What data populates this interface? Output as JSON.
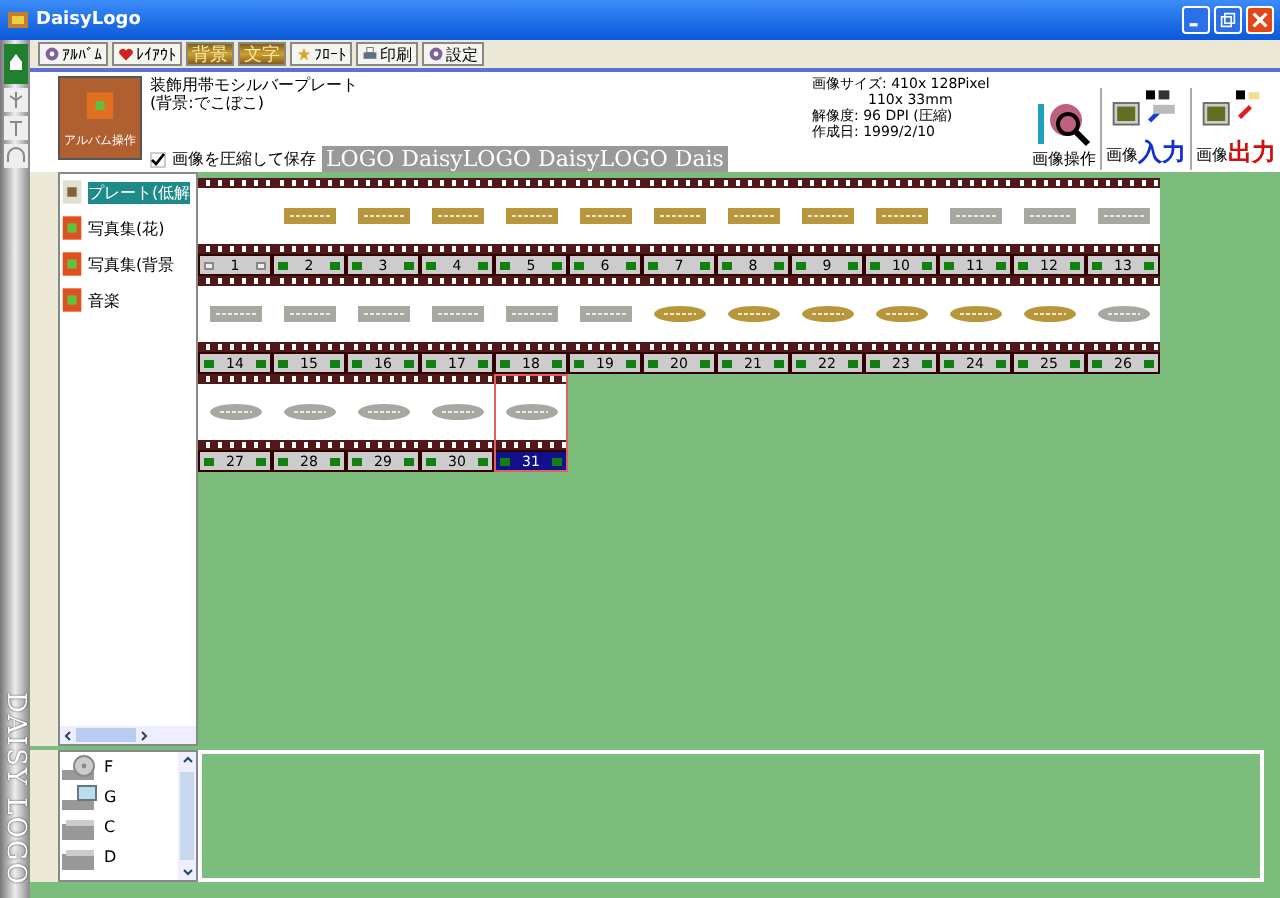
{
  "window": {
    "title": "DaisyLogo"
  },
  "side_strip": {
    "label": "DAISY LOGO"
  },
  "toolbar": [
    {
      "label": "ｱﾙﾊﾞﾑ",
      "kind": "album",
      "selected": false
    },
    {
      "label": "ﾚｲｱｳﾄ",
      "kind": "layout",
      "selected": false
    },
    {
      "label": "背景",
      "kind": "background",
      "selected": true
    },
    {
      "label": "文字",
      "kind": "text",
      "selected": true
    },
    {
      "label": "ﾌﾛｰﾄ",
      "kind": "float",
      "selected": false
    },
    {
      "label": "印刷",
      "kind": "print",
      "selected": false
    },
    {
      "label": "設定",
      "kind": "settings",
      "selected": false
    }
  ],
  "album": {
    "button": "アルバム操作",
    "title": "装飾用帯モシルバープレート",
    "subtitle": "(背景:でこぼこ)",
    "compress": {
      "label": "画像を圧縮して保存",
      "checked": true
    },
    "banner": "LOGO DaisyLOGO DaisyLOGO Dais"
  },
  "image_info": [
    "画像サイズ: 410x 128Pixel",
    "110x 33mm",
    "解像度: 96 DPI (圧縮)",
    "作成日: 1999/2/10"
  ],
  "actions": [
    {
      "kind": "edit",
      "label": "画像操作"
    },
    {
      "kind": "input",
      "label": "画像",
      "emphasis": "入力"
    },
    {
      "kind": "output",
      "label": "画像",
      "emphasis": "出力"
    }
  ],
  "albums": [
    {
      "label": "プレート(低解",
      "selected": true
    },
    {
      "label": "写真集(花)",
      "selected": false
    },
    {
      "label": "写真集(背景",
      "selected": false
    },
    {
      "label": "音楽",
      "selected": false
    }
  ],
  "thumbnails": [
    {
      "label": "1",
      "kind": "empty",
      "selected": false
    },
    {
      "label": "2",
      "kind": "bar",
      "color": "#b8963c",
      "selected": false
    },
    {
      "label": "3",
      "kind": "bar",
      "color": "#b8963c",
      "selected": false
    },
    {
      "label": "4",
      "kind": "bar",
      "color": "#b8963c",
      "selected": false
    },
    {
      "label": "5",
      "kind": "bar",
      "color": "#b8963c",
      "selected": false
    },
    {
      "label": "6",
      "kind": "bar",
      "color": "#b8963c",
      "selected": false
    },
    {
      "label": "7",
      "kind": "bar",
      "color": "#b8963c",
      "selected": false
    },
    {
      "label": "8",
      "kind": "bar",
      "color": "#b8963c",
      "selected": false
    },
    {
      "label": "9",
      "kind": "bar",
      "color": "#b8963c",
      "selected": false
    },
    {
      "label": "10",
      "kind": "bar",
      "color": "#b8963c",
      "selected": false
    },
    {
      "label": "11",
      "kind": "bar",
      "color": "#a8a8a0",
      "selected": false
    },
    {
      "label": "12",
      "kind": "bar",
      "color": "#a8a8a0",
      "selected": false
    },
    {
      "label": "13",
      "kind": "bar",
      "color": "#a8a8a0",
      "selected": false
    },
    {
      "label": "14",
      "kind": "bar",
      "color": "#a8a8a0",
      "selected": false
    },
    {
      "label": "15",
      "kind": "bar",
      "color": "#a8a8a0",
      "selected": false
    },
    {
      "label": "16",
      "kind": "bar",
      "color": "#a8a8a0",
      "selected": false
    },
    {
      "label": "17",
      "kind": "bar",
      "color": "#a8a8a0",
      "selected": false
    },
    {
      "label": "18",
      "kind": "bar",
      "color": "#a8a8a0",
      "selected": false
    },
    {
      "label": "19",
      "kind": "bar",
      "color": "#a8a8a0",
      "selected": false
    },
    {
      "label": "20",
      "kind": "oval",
      "color": "#b8963c",
      "selected": false
    },
    {
      "label": "21",
      "kind": "oval",
      "color": "#b8963c",
      "selected": false
    },
    {
      "label": "22",
      "kind": "oval",
      "color": "#b8963c",
      "selected": false
    },
    {
      "label": "23",
      "kind": "oval",
      "color": "#b8963c",
      "selected": false
    },
    {
      "label": "24",
      "kind": "oval",
      "color": "#b8963c",
      "selected": false
    },
    {
      "label": "25",
      "kind": "oval",
      "color": "#b8963c",
      "selected": false
    },
    {
      "label": "26",
      "kind": "oval",
      "color": "#a8a8a0",
      "selected": false
    },
    {
      "label": "27",
      "kind": "oval",
      "color": "#a8a8a0",
      "selected": false
    },
    {
      "label": "28",
      "kind": "oval",
      "color": "#a8a8a0",
      "selected": false
    },
    {
      "label": "29",
      "kind": "oval",
      "color": "#a8a8a0",
      "selected": false
    },
    {
      "label": "30",
      "kind": "oval",
      "color": "#a8a8a0",
      "selected": false
    },
    {
      "label": "31",
      "kind": "oval",
      "color": "#a8a8a0",
      "selected": true
    }
  ],
  "drives": [
    {
      "label": "F",
      "kind": "cd"
    },
    {
      "label": "G",
      "kind": "network"
    },
    {
      "label": "C",
      "kind": "disk"
    },
    {
      "label": "D",
      "kind": "disk"
    }
  ]
}
